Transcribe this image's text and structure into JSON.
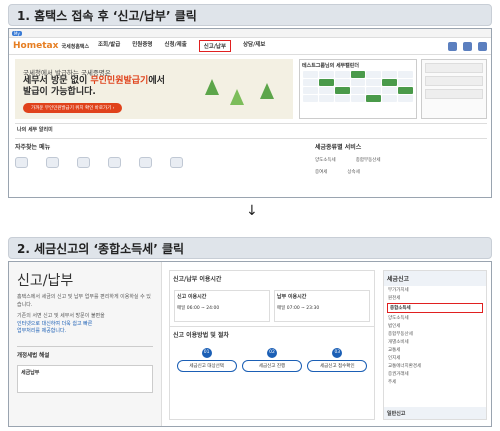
{
  "step1": {
    "heading": "1. 홈택스 접속 후 ‘신고/납부’ 클릭"
  },
  "step2": {
    "heading": "2. 세금신고의 ‘종합소득세’ 클릭"
  },
  "arrow": "↓",
  "hometax": {
    "logo": "Hometax",
    "logo_sub": "국세청홈택스",
    "nav": [
      "조회/발급",
      "민원증명",
      "신청/제출",
      "신고/납부",
      "상담/제보"
    ],
    "banner_line1": "국세청에서 발급하는 국세증명은",
    "banner_line2a": "세무서 방문 없이 ",
    "banner_line2b": "무인민원발급기",
    "banner_line2c": "에서",
    "banner_line3": "발급이 가능합니다.",
    "banner_button": "가까운 무인민원발급기 위치 확인 바로가기 ›",
    "calendar_title": "테스트그룹님의 세무캘린더",
    "alert_title": "나의 세무 알리미",
    "quick_title": "자주찾는 메뉴",
    "svc_title": "세금종류별 서비스",
    "svc_items": [
      "양도소득세",
      "종합부동산세",
      "증여세",
      "상속세"
    ]
  },
  "tax_report": {
    "title": "신고/납부",
    "desc": "홈택스에서 세금의 신고 및 납부 업무를 편리하게 이용하실 수 있습니다.",
    "desc2": "기존의 서면 신고 및 세무서 방문이 불편을",
    "desc3": "인터넷으로 대신하여 더욱 쉽고 빠른",
    "desc4": "업무처리를 제공합니다.",
    "section": "개정세법 해설",
    "sub": "세금납부",
    "time_title": "신고/납부 이용시간",
    "time_left_title": "신고 이용시간",
    "time_left": "매일 06:00 ~ 24:00",
    "time_right_title": "납부 이용시간",
    "time_right": "매일 07:00 ~ 23:30",
    "process_title": "신고 이용방법 및 절차",
    "steps": [
      {
        "num": "01",
        "label": "세금신고 대상선택"
      },
      {
        "num": "02",
        "label": "세금신고 진행"
      },
      {
        "num": "03",
        "label": "세금신고 접수확인"
      }
    ],
    "side_title": "세금신고",
    "side_items": [
      "부가가치세",
      "원천세",
      "종합소득세",
      "양도소득세",
      "법인세",
      "종합부동산세",
      "개별소비세",
      "교통세",
      "인지세",
      "교통에너지환경세",
      "증권거래세",
      "주세"
    ],
    "side_highlight": "종합소득세",
    "side_footer": "일반신고"
  }
}
